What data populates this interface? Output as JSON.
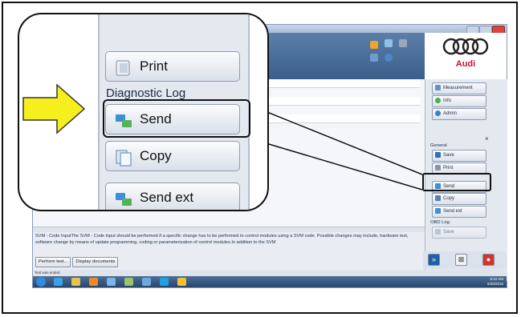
{
  "brand": {
    "name": "Audi",
    "color": "#c8102e"
  },
  "right_panel": {
    "top_items": [
      {
        "label": "Measurement",
        "icon": "measurement-icon"
      },
      {
        "label": "Info",
        "icon": "info-icon"
      },
      {
        "label": "Admin",
        "icon": "admin-icon"
      }
    ],
    "close_glyph": "×",
    "section_general": "General",
    "general_items": [
      {
        "label": "Save",
        "icon": "save-icon"
      },
      {
        "label": "Print",
        "icon": "print-icon"
      }
    ],
    "diagnostic_items": [
      {
        "label": "Send",
        "icon": "send-icon"
      },
      {
        "label": "Copy",
        "icon": "copy-icon"
      },
      {
        "label": "Send ext",
        "icon": "send-ext-icon"
      }
    ],
    "section_obd": "OBD Log",
    "obd_item": "Save"
  },
  "main": {
    "info_text": "SVM - Code InputThe SVM - Code input should be performed if a specific change has to be performed to control modules using a SVM code. Possible changes may include, hardware test, software change by means of update programming, coding or parameterization of control modules.In addition to the SVM",
    "buttons": {
      "perform_test": "Perform test...",
      "display_documents": "Display documents"
    }
  },
  "status_bar": {
    "text": "Test was ended."
  },
  "taskbar": {
    "time": "8:22 AM",
    "date": "6/28/2016"
  },
  "zoom": {
    "print_label": "Print",
    "section_label": "Diagnostic Log",
    "send_label": "Send",
    "copy_label": "Copy",
    "send_ext_label": "Send ext"
  },
  "colors": {
    "arrow_fill": "#f5ef1d",
    "highlight_border": "#111111"
  }
}
